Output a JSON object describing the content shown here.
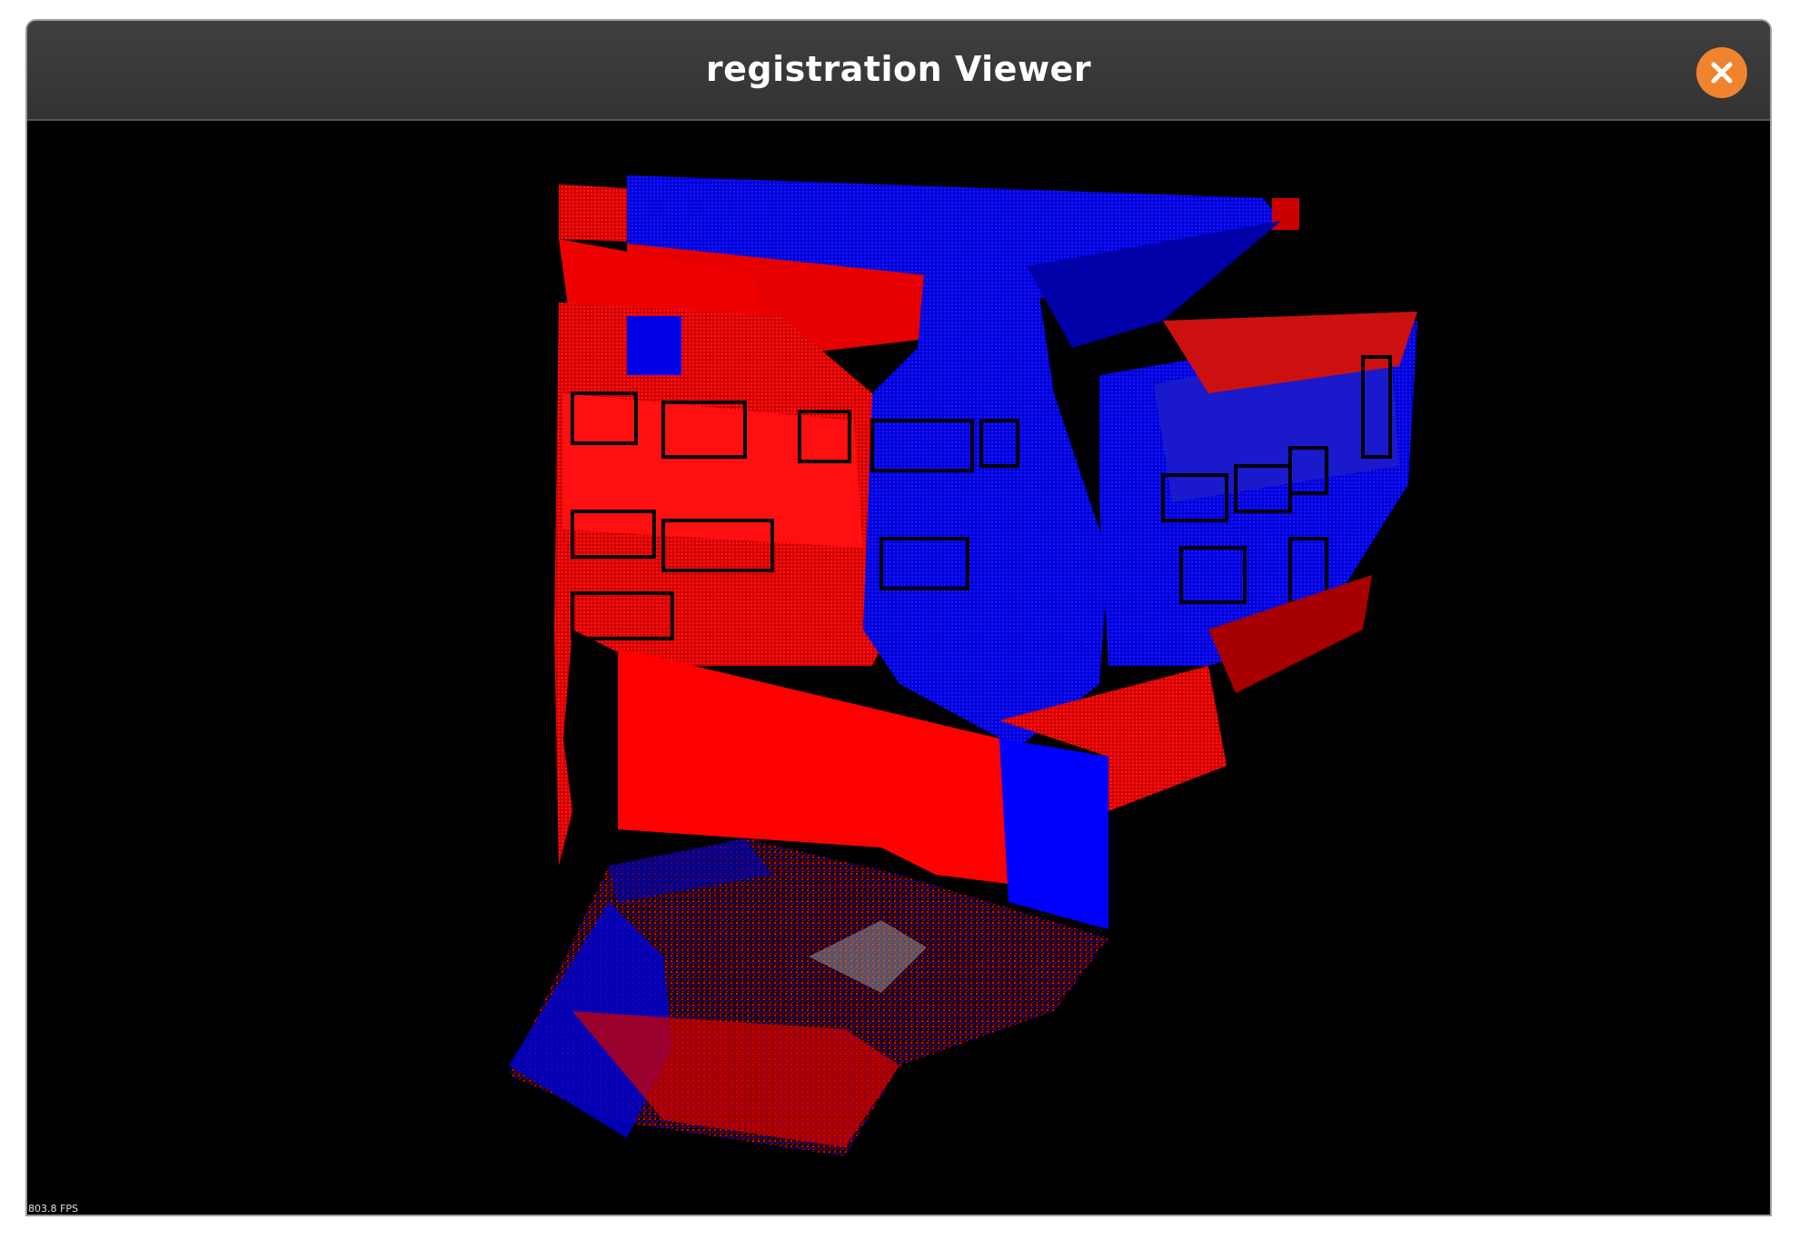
{
  "window": {
    "title": "registration Viewer"
  },
  "toolbar": {
    "close_icon": "close-icon",
    "close_color": "#f0832e"
  },
  "viewport": {
    "fps_text": "803.8 FPS",
    "background": "#000000",
    "point_cloud_colors": {
      "source": "#ff0000",
      "target": "#0000ff"
    }
  }
}
